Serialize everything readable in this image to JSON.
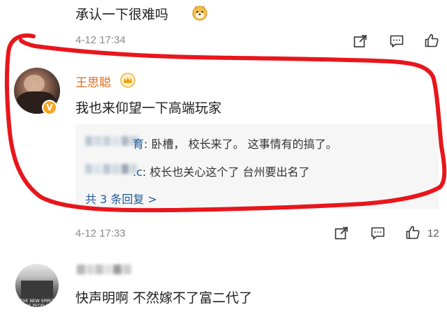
{
  "top_comment": {
    "text": "承认一下很难吗",
    "emoji": "doge-emoji",
    "time": "4-12 17:34"
  },
  "main_comment": {
    "username": "王思聪",
    "badge": "crown-badge",
    "text": "我也来仰望一下高端玩家",
    "replies": [
      {
        "user_suffix": "育",
        "text": ": 卧槽， 校长来了。 这事情有的搞了。"
      },
      {
        "user_suffix": ".c",
        "text": ": 校长也关心这个了 台州要出名了"
      }
    ],
    "more_replies": "共 3 条回复 >",
    "time": "4-12 17:33",
    "like_count": "12"
  },
  "bottom_comment": {
    "text": "快声明啊 不然嫁不了富二代了",
    "avatar_caption": "THE NEW SPIRIT OF PEOPLE"
  },
  "colors": {
    "username": "#e06a1a",
    "annotation_red": "#e8161c",
    "reply_bg": "#f6f6f6",
    "meta_text": "#8a8a8a"
  },
  "icons": [
    "share-icon",
    "comment-icon",
    "like-icon",
    "verified-icon",
    "crown-badge-icon"
  ]
}
